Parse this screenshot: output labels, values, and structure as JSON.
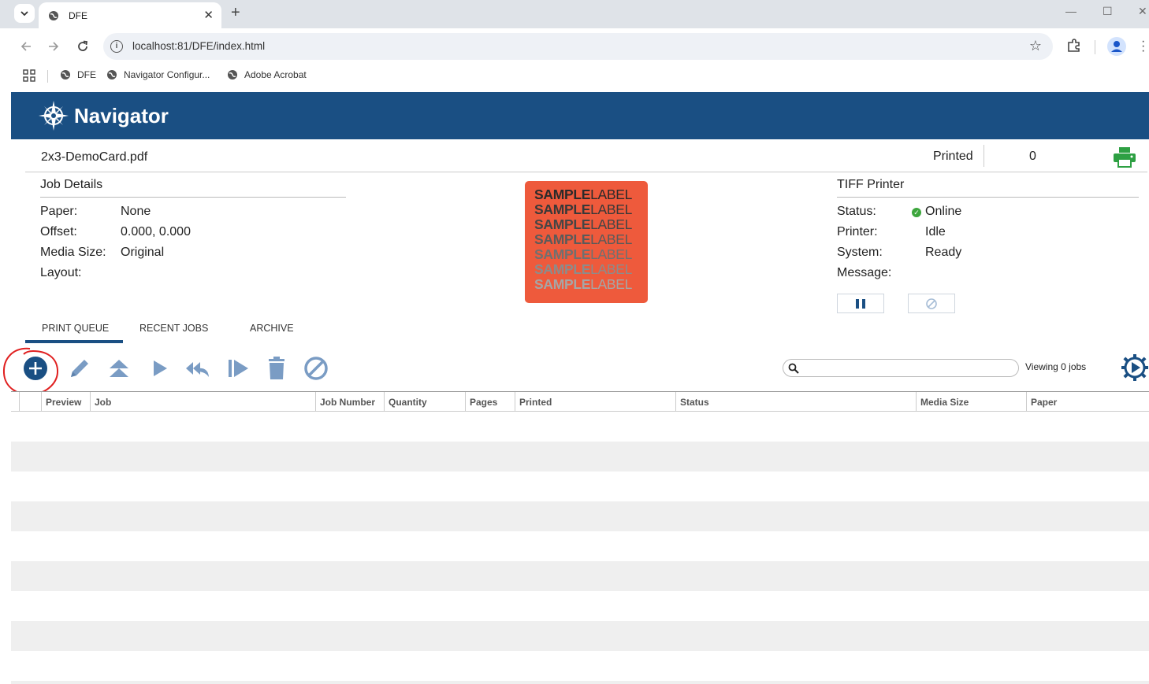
{
  "browser": {
    "tab_title": "DFE",
    "url": "localhost:81/DFE/index.html",
    "bookmarks": [
      "DFE",
      "Navigator Configur...",
      "Adobe Acrobat"
    ]
  },
  "app": {
    "logo_text": "Navigator",
    "file_name": "2x3-DemoCard.pdf",
    "printed_label": "Printed",
    "printed_count": "0",
    "job_details": {
      "title": "Job Details",
      "rows": [
        {
          "label": "Paper:",
          "value": "None"
        },
        {
          "label": "Offset:",
          "value": "0.000, 0.000"
        },
        {
          "label": "Media Size:",
          "value": "Original"
        },
        {
          "label": "Layout:",
          "value": ""
        }
      ]
    },
    "preview": {
      "lines": [
        {
          "bold": "SAMPLE",
          "light": "LABEL"
        },
        {
          "bold": "SAMPLE",
          "light": "LABEL"
        },
        {
          "bold": "SAMPLE",
          "light": "LABEL"
        },
        {
          "bold": "SAMPLE",
          "light": "LABEL"
        },
        {
          "bold": "SAMPLE",
          "light": "LABEL"
        },
        {
          "bold": "SAMPLE",
          "light": "LABEL"
        },
        {
          "bold": "SAMPLE",
          "light": "LABEL"
        }
      ]
    },
    "printer": {
      "title": "TIFF Printer",
      "rows": [
        {
          "label": "Status:",
          "value": "Online"
        },
        {
          "label": "Printer:",
          "value": "Idle"
        },
        {
          "label": "System:",
          "value": "Ready"
        },
        {
          "label": "Message:",
          "value": ""
        }
      ]
    },
    "queue_tabs": [
      "PRINT QUEUE",
      "RECENT JOBS",
      "ARCHIVE"
    ],
    "action_icons": [
      "add-job-icon",
      "edit-icon",
      "move-to-top-icon",
      "play-icon",
      "reprint-icon",
      "step-play-icon",
      "delete-icon",
      "cancel-icon"
    ],
    "search_placeholder": "",
    "viewing_text": "Viewing 0 jobs",
    "columns": [
      "Preview",
      "Job",
      "Job Number",
      "Quantity",
      "Pages",
      "Printed",
      "Status",
      "Media Size",
      "Paper"
    ],
    "colors": {
      "header": "#1a4f83",
      "icon": "#7a9cc4",
      "accent_green": "#2ea043",
      "preview_bg": "#ee5a3c"
    }
  }
}
